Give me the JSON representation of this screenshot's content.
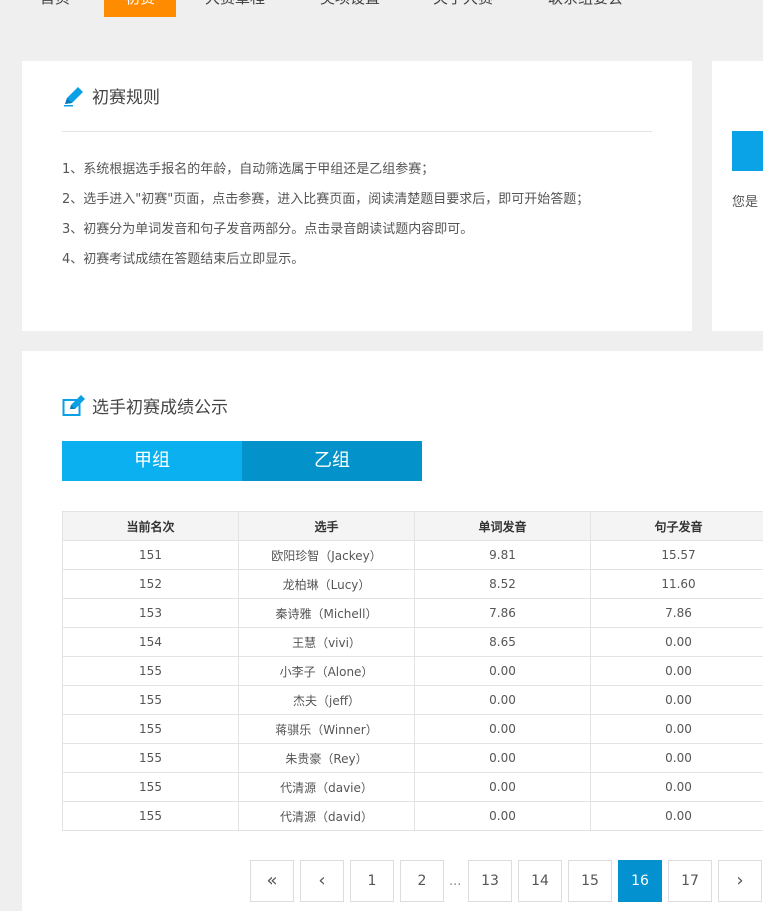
{
  "nav": {
    "items": [
      "首页",
      "初赛",
      "大赛章程",
      "奖项设置",
      "关于大赛",
      "联系组委会"
    ],
    "active_index": 1
  },
  "rules": {
    "title": "初赛规则",
    "lines": [
      "1、系统根据选手报名的年龄，自动筛选属于甲组还是乙组参赛；",
      "2、选手进入\"初赛\"页面，点击参赛，进入比赛页面，阅读清楚题目要求后，即可开始答题；",
      "3、初赛分为单词发音和句子发音两部分。点击录音朗读试题内容即可。",
      "4、初赛考试成绩在答题结束后立即显示。"
    ]
  },
  "side": {
    "text": "您是"
  },
  "results": {
    "title": "选手初赛成绩公示",
    "tabs": [
      "甲组",
      "乙组"
    ],
    "columns": [
      "当前名次",
      "选手",
      "单词发音",
      "句子发音"
    ],
    "rows": [
      [
        "151",
        "欧阳珍智（Jackey）",
        "9.81",
        "15.57"
      ],
      [
        "152",
        "龙柏琳（Lucy）",
        "8.52",
        "11.60"
      ],
      [
        "153",
        "秦诗雅（Michell）",
        "7.86",
        "7.86"
      ],
      [
        "154",
        "王慧（vivi）",
        "8.65",
        "0.00"
      ],
      [
        "155",
        "小李子（Alone）",
        "0.00",
        "0.00"
      ],
      [
        "155",
        "杰夫（jeff）",
        "0.00",
        "0.00"
      ],
      [
        "155",
        "蒋骐乐（Winner）",
        "0.00",
        "0.00"
      ],
      [
        "155",
        "朱贵豪（Rey）",
        "0.00",
        "0.00"
      ],
      [
        "155",
        "代清源（davie）",
        "0.00",
        "0.00"
      ],
      [
        "155",
        "代清源（david）",
        "0.00",
        "0.00"
      ]
    ]
  },
  "pagination": {
    "first": "«",
    "prev": "‹",
    "next": "›",
    "ellipsis": "...",
    "pages": [
      "1",
      "2",
      "13",
      "14",
      "15",
      "16",
      "17"
    ],
    "current": "16"
  },
  "colors": {
    "nav_active": "#ff8b00",
    "tab_a": "#0ab0ef",
    "tab_b": "#0392c9",
    "page_active": "#0391cf"
  }
}
